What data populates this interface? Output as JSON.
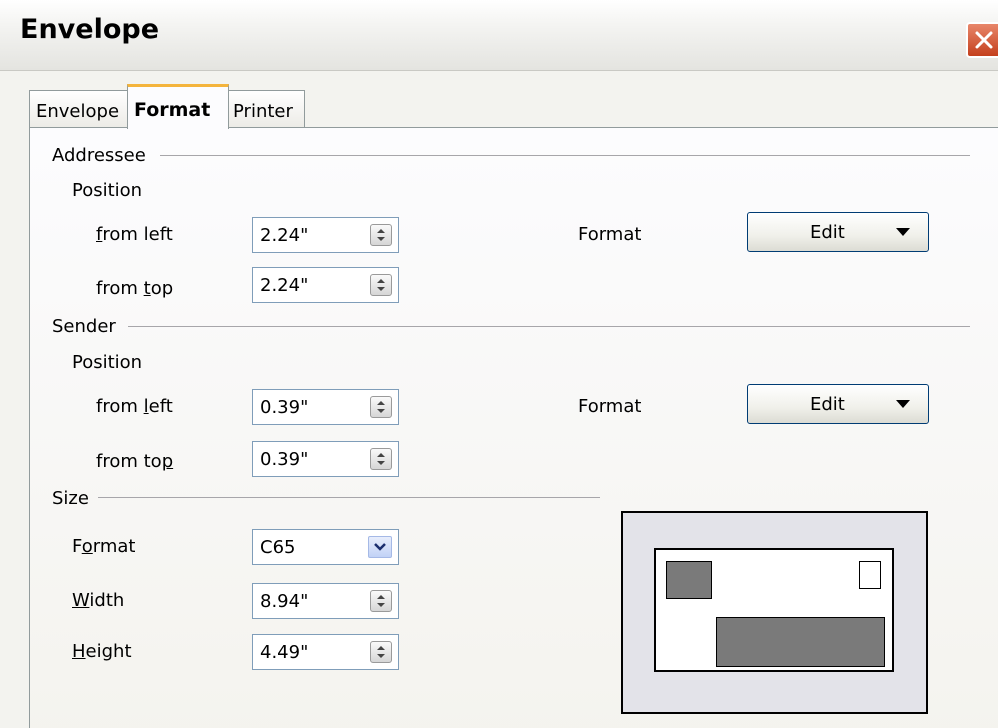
{
  "window": {
    "title": "Envelope"
  },
  "tabs": [
    {
      "label": "Envelope",
      "active": false
    },
    {
      "label": "Format",
      "active": true
    },
    {
      "label": "Printer",
      "active": false
    }
  ],
  "addressee": {
    "heading": "Addressee",
    "position_label": "Position",
    "from_left": {
      "pre": "",
      "key": "f",
      "post": "rom left",
      "value": "2.24\""
    },
    "from_top": {
      "pre": "from ",
      "key": "t",
      "post": "op",
      "value": "2.24\""
    },
    "format_label": "Format",
    "edit_label": "Edit"
  },
  "sender": {
    "heading": "Sender",
    "position_label": "Position",
    "from_left": {
      "pre": "from ",
      "key": "l",
      "post": "eft",
      "value": "0.39\""
    },
    "from_top": {
      "pre": "from to",
      "key": "p",
      "post": "",
      "value": "0.39\""
    },
    "format_label": "Format",
    "edit_label": "Edit"
  },
  "size": {
    "heading": "Size",
    "format": {
      "pre": "F",
      "key": "o",
      "post": "rmat",
      "value": "C65"
    },
    "width": {
      "pre": "",
      "key": "W",
      "post": "idth",
      "value": "8.94\""
    },
    "height": {
      "pre": "",
      "key": "H",
      "post": "eight",
      "value": "4.49\""
    }
  },
  "colors": {
    "tab_highlight": "#f4b43c",
    "close_button": "#c4401d",
    "preview_block": "#7a7a7a"
  }
}
